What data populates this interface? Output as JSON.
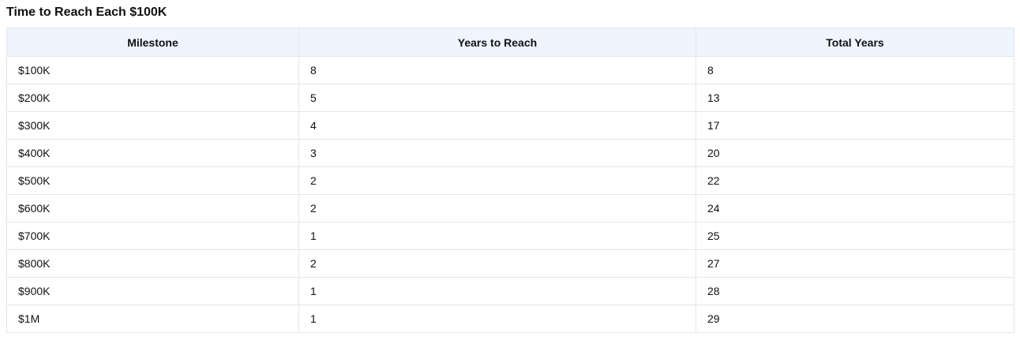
{
  "title": "Time to Reach Each $100K",
  "table": {
    "headers": [
      "Milestone",
      "Years to Reach",
      "Total Years"
    ],
    "rows": [
      [
        "$100K",
        "8",
        "8"
      ],
      [
        "$200K",
        "5",
        "13"
      ],
      [
        "$300K",
        "4",
        "17"
      ],
      [
        "$400K",
        "3",
        "20"
      ],
      [
        "$500K",
        "2",
        "22"
      ],
      [
        "$600K",
        "2",
        "24"
      ],
      [
        "$700K",
        "1",
        "25"
      ],
      [
        "$800K",
        "2",
        "27"
      ],
      [
        "$900K",
        "1",
        "28"
      ],
      [
        "$1M",
        "1",
        "29"
      ]
    ]
  }
}
